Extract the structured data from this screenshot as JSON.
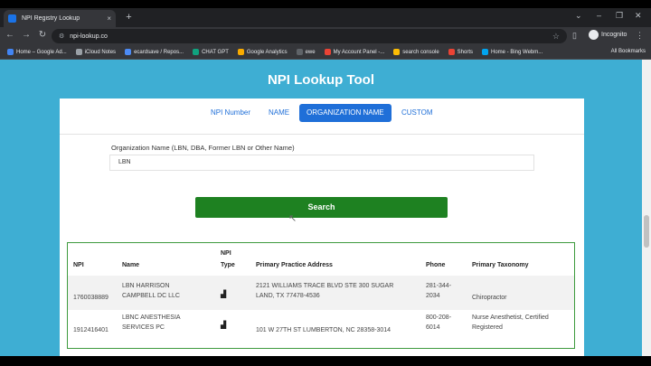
{
  "browser": {
    "tab_title": "NPI Registry Lookup",
    "tab_close": "×",
    "new_tab": "+",
    "url": "npi-lookup.co",
    "profile_label": "Incognito",
    "bookmarks": [
      {
        "label": "Home – Google Ad...",
        "color": "#4285f4"
      },
      {
        "label": "iCloud Notes",
        "color": "#9aa0a6"
      },
      {
        "label": "ecardsave / Repos...",
        "color": "#4c8bf5"
      },
      {
        "label": "CHAT GPT",
        "color": "#10a37f"
      },
      {
        "label": "Google Analytics",
        "color": "#f9ab00"
      },
      {
        "label": "ewe",
        "color": "#5f6368"
      },
      {
        "label": "My Account Panel -...",
        "color": "#ea4335"
      },
      {
        "label": "search console",
        "color": "#fbbc04"
      },
      {
        "label": "Shorts",
        "color": "#ea4335"
      },
      {
        "label": "Home - Bing Webm...",
        "color": "#00a4ef"
      }
    ],
    "all_bookmarks": "All Bookmarks"
  },
  "page": {
    "title": "NPI Lookup Tool",
    "tabs": [
      {
        "label": "NPI Number",
        "active": false
      },
      {
        "label": "NAME",
        "active": false
      },
      {
        "label": "ORGANIZATION NAME",
        "active": true
      },
      {
        "label": "CUSTOM",
        "active": false
      }
    ],
    "field_label": "Organization Name (LBN, DBA, Former LBN or Other Name)",
    "field_value": "LBN",
    "search_label": "Search"
  },
  "results": {
    "headers": {
      "npi": "NPI",
      "name": "Name",
      "npi_type_1": "NPI",
      "npi_type_2": "Type",
      "address": "Primary Practice Address",
      "phone": "Phone",
      "taxonomy": "Primary Taxonomy"
    },
    "rows": [
      {
        "npi": "1760038889",
        "name_1": "LBN HARRISON",
        "name_2": "CAMPBELL DC LLC",
        "address_1": "2121 WILLIAMS TRACE BLVD STE 300 SUGAR",
        "address_2": "LAND, TX 77478-4536",
        "phone_1": "281-344-",
        "phone_2": "2034",
        "taxonomy_1": "Chiropractor",
        "taxonomy_2": ""
      },
      {
        "npi": "1912416401",
        "name_1": "LBNC ANESTHESIA",
        "name_2": "SERVICES PC",
        "address_1": "101 W 27TH ST LUMBERTON, NC 28358-3014",
        "address_2": "",
        "phone_1": "800-208-",
        "phone_2": "6014",
        "taxonomy_1": "Nurse Anesthetist, Certified",
        "taxonomy_2": "Registered"
      }
    ]
  }
}
